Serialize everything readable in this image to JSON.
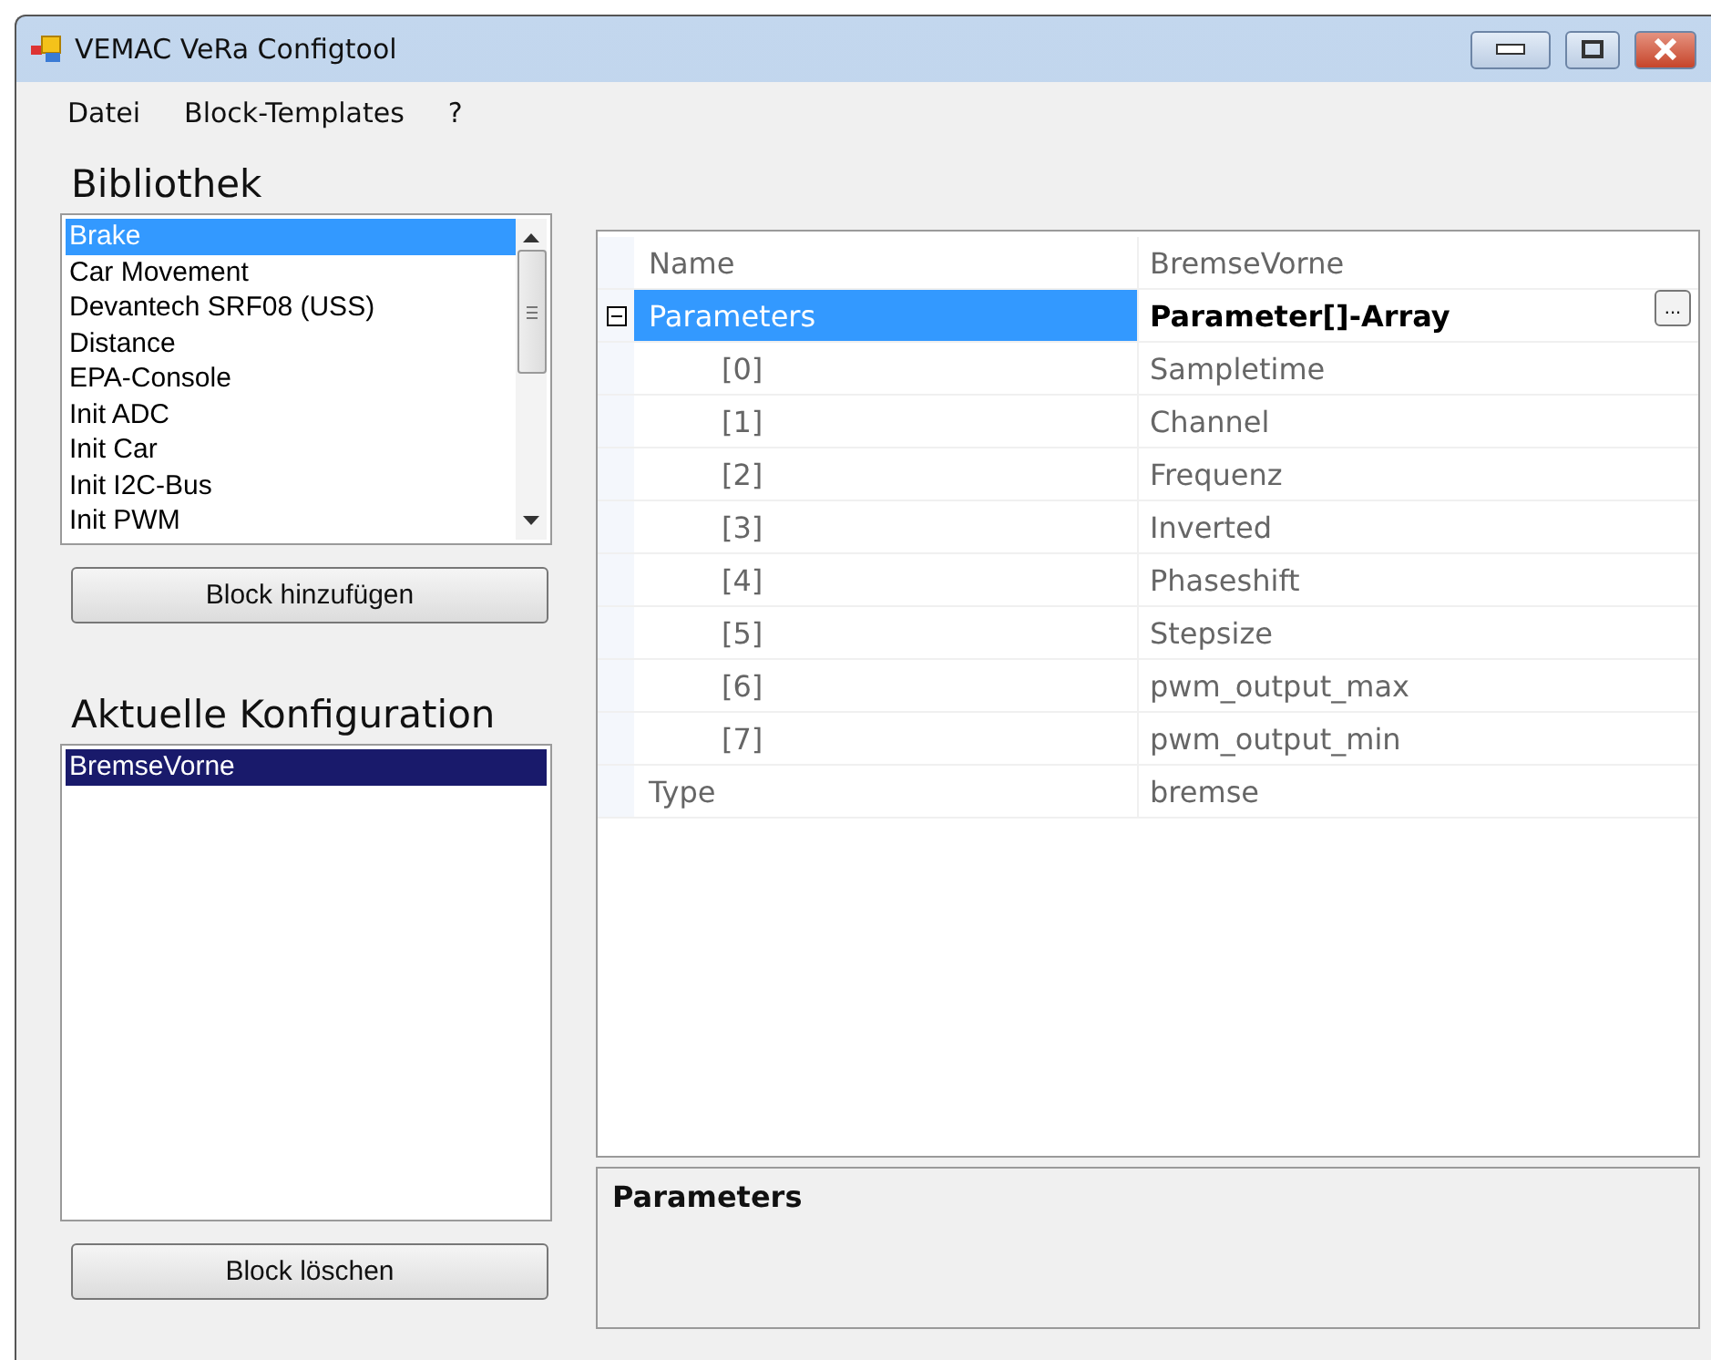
{
  "window": {
    "title": "VEMAC VeRa Configtool"
  },
  "menu": [
    "Datei",
    "Block-Templates",
    "?"
  ],
  "library": {
    "heading": "Bibliothek",
    "items": [
      {
        "label": "Brake",
        "selected": true
      },
      {
        "label": "Car Movement",
        "selected": false
      },
      {
        "label": "Devantech SRF08 (USS)",
        "selected": false
      },
      {
        "label": "Distance",
        "selected": false
      },
      {
        "label": "EPA-Console",
        "selected": false
      },
      {
        "label": "Init ADC",
        "selected": false
      },
      {
        "label": "Init Car",
        "selected": false
      },
      {
        "label": "Init I2C-Bus",
        "selected": false
      },
      {
        "label": "Init PWM",
        "selected": false
      }
    ],
    "button": "Block hinzufügen"
  },
  "configuration": {
    "heading": "Aktuelle Konfiguration",
    "items": [
      {
        "label": "BremseVorne",
        "selected": true
      }
    ],
    "button": "Block löschen"
  },
  "property_grid": {
    "rows": [
      {
        "name": "Name",
        "value": "BremseVorne",
        "selected": false
      },
      {
        "name": "Parameters",
        "value": "Parameter[]-Array",
        "selected": true,
        "expanded": true,
        "button": "...",
        "children": [
          {
            "name": "[0]",
            "value": "Sampletime",
            "selected": false
          },
          {
            "name": "[1]",
            "value": "Channel",
            "selected": false
          },
          {
            "name": "[2]",
            "value": "Frequenz",
            "selected": false
          },
          {
            "name": "[3]",
            "value": "Inverted",
            "selected": false
          },
          {
            "name": "[4]",
            "value": "Phaseshift",
            "selected": false
          },
          {
            "name": "[5]",
            "value": "Stepsize",
            "selected": false
          },
          {
            "name": "[6]",
            "value": "pwm_output_max",
            "selected": false
          },
          {
            "name": "[7]",
            "value": "pwm_output_min",
            "selected": false
          }
        ]
      },
      {
        "name": "Type",
        "value": "bremse",
        "selected": false
      }
    ]
  },
  "help": {
    "title": "Parameters"
  }
}
